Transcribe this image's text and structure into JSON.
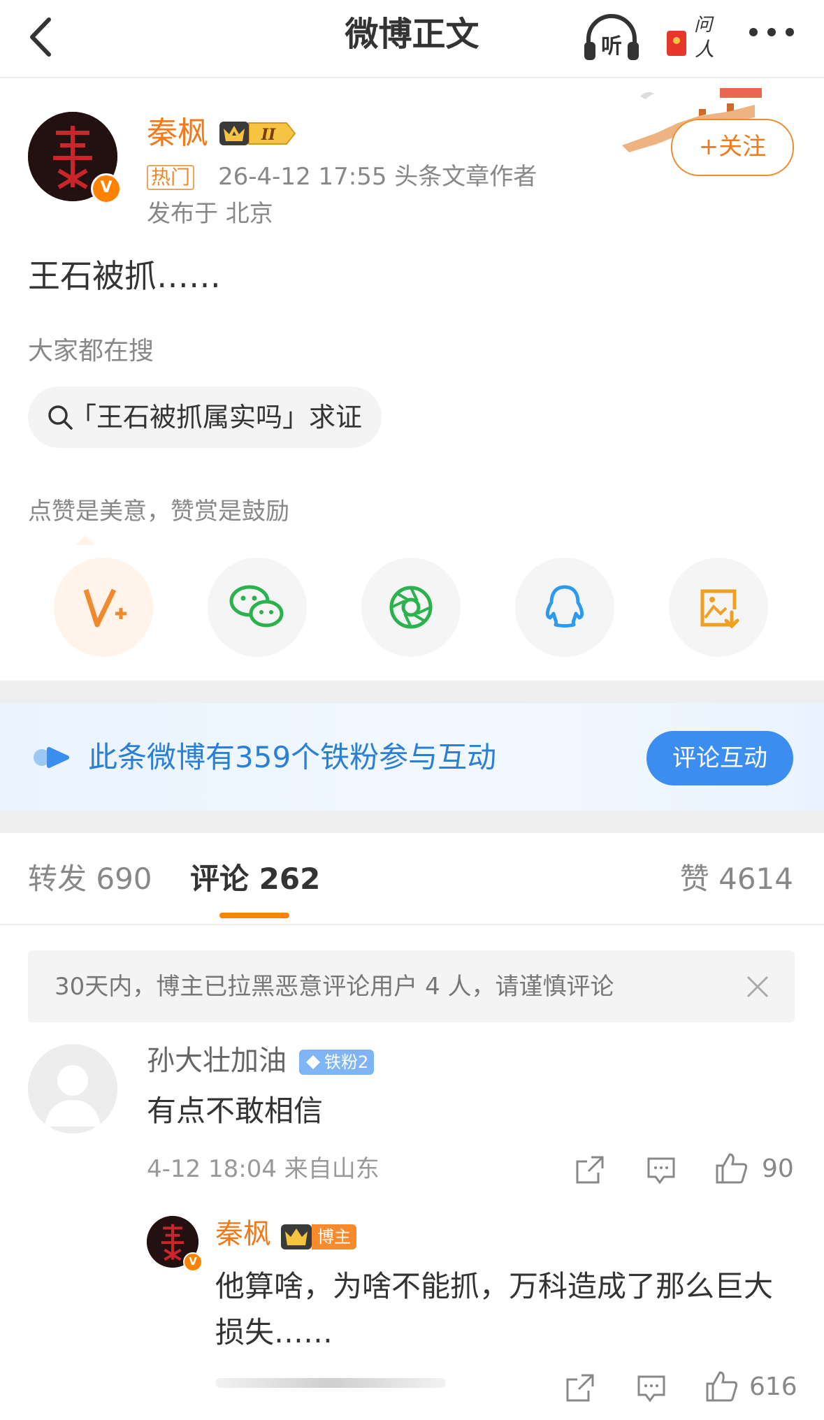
{
  "nav": {
    "title": "微博正文",
    "listen_label": "听",
    "ask_label": "问人"
  },
  "author": {
    "name": "秦枫",
    "level": "II",
    "hot_tag": "热门",
    "meta": "26-4-12 17:55  头条文章作者",
    "location": "发布于 北京",
    "follow_label": "+关注",
    "verified_badge": "V"
  },
  "post": {
    "text": "王石被抓……"
  },
  "search": {
    "label": "大家都在搜",
    "query": "「王石被抓属实吗」求证"
  },
  "praise": {
    "label": "点赞是美意，赞赏是鼓励",
    "buttons": [
      {
        "icon": "v-plus-icon",
        "color": "#f08a2e"
      },
      {
        "icon": "wechat-icon",
        "color": "#2ab24c"
      },
      {
        "icon": "moments-icon",
        "color": "#2ab24c"
      },
      {
        "icon": "qq-icon",
        "color": "#2d9af0"
      },
      {
        "icon": "save-image-icon",
        "color": "#f0a020"
      }
    ]
  },
  "fans_banner": {
    "text": "此条微博有359个铁粉参与互动",
    "button_label": "评论互动"
  },
  "tabs": {
    "repost": "转发 690",
    "comment": "评论 262",
    "like": "赞 4614"
  },
  "notice": {
    "text": "30天内，博主已拉黑恶意评论用户 4 人，请谨慎评论"
  },
  "comment": {
    "user": "孙大壮加油",
    "badge": "铁粉2",
    "text": "有点不敢相信",
    "meta": "4-12 18:04  来自山东",
    "likes": "90"
  },
  "reply": {
    "user": "秦枫",
    "tag": "博主",
    "text": "他算啥，为啥不能抓，万科造成了那么巨大损失……",
    "likes": "616"
  },
  "colors": {
    "accent": "#ff8200",
    "link_blue": "#2a7fd6",
    "button_blue": "#3b8df0"
  }
}
